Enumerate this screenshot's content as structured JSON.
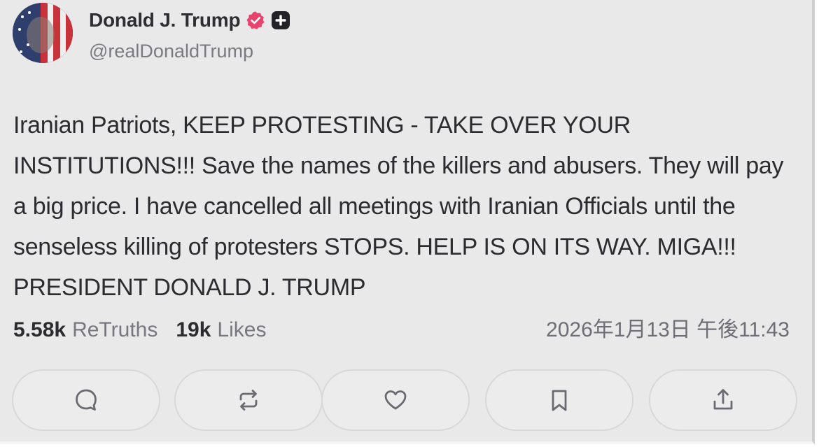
{
  "author": {
    "display_name": "Donald J. Trump",
    "handle": "@realDonaldTrump",
    "verified_icon": "verified-badge-icon",
    "badge_icon": "plus-badge-icon",
    "avatar": "avatar-image"
  },
  "post": {
    "text": "Iranian Patriots, KEEP PROTESTING - TAKE OVER YOUR INSTITUTIONS!!! Save the names of the killers and abusers. They will pay a big price. I have cancelled all meetings with Iranian Officials until the senseless killing of protesters STOPS. HELP IS ON ITS WAY. MIGA!!! PRESIDENT DONALD J. TRUMP"
  },
  "stats": {
    "retruths_count": "5.58k",
    "retruths_label": "ReTruths",
    "likes_count": "19k",
    "likes_label": "Likes",
    "timestamp": "2026年1月13日 午後11:43"
  },
  "actions": [
    {
      "name": "reply",
      "icon": "comment-icon"
    },
    {
      "name": "retruth",
      "icon": "repost-icon"
    },
    {
      "name": "like",
      "icon": "heart-icon"
    },
    {
      "name": "bookmark",
      "icon": "bookmark-icon"
    },
    {
      "name": "share",
      "icon": "share-icon"
    }
  ],
  "colors": {
    "background": "#e9e9e9",
    "text": "#2b2b30",
    "muted": "#777780",
    "verified": "#e8436b"
  }
}
